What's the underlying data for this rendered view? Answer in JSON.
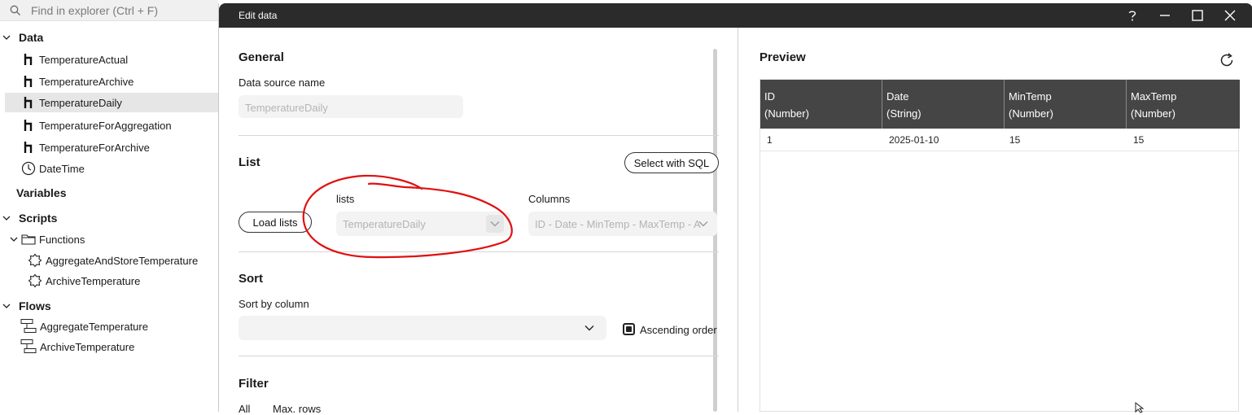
{
  "explorer": {
    "search_placeholder": "Find in explorer (Ctrl + F)",
    "sections": {
      "data": "Data",
      "variables": "Variables",
      "scripts": "Scripts",
      "flows": "Flows"
    },
    "data_items": [
      "TemperatureActual",
      "TemperatureArchive",
      "TemperatureDaily",
      "TemperatureForAggregation",
      "TemperatureForArchive",
      "DateTime"
    ],
    "functions_folder": "Functions",
    "script_items": [
      "AggregateAndStoreTemperature",
      "ArchiveTemperature"
    ],
    "flow_items": [
      "AggregateTemperature",
      "ArchiveTemperature"
    ]
  },
  "dialog": {
    "title": "Edit data",
    "general": {
      "heading": "General",
      "name_label": "Data source name",
      "name_value": "TemperatureDaily"
    },
    "list": {
      "heading": "List",
      "select_sql_label": "Select with SQL",
      "load_lists_label": "Load lists",
      "lists_label": "lists",
      "lists_value": "TemperatureDaily",
      "columns_label": "Columns",
      "columns_value": "ID - Date - MinTemp - MaxTemp - A"
    },
    "sort": {
      "heading": "Sort",
      "sort_by_label": "Sort by column",
      "sort_by_value": "",
      "ascending_label": "Ascending order",
      "ascending_checked": true
    },
    "filter": {
      "heading": "Filter",
      "all_label": "All",
      "max_rows_label": "Max. rows"
    },
    "preview": {
      "heading": "Preview",
      "columns": [
        {
          "name": "ID",
          "type": "(Number)"
        },
        {
          "name": "Date",
          "type": "(String)"
        },
        {
          "name": "MinTemp",
          "type": "(Number)"
        },
        {
          "name": "MaxTemp",
          "type": "(Number)"
        }
      ],
      "rows": [
        [
          "1",
          "2025-01-10",
          "15",
          "15"
        ]
      ]
    }
  },
  "colors": {
    "titlebar": "#2b2b2b",
    "table_header": "#454545",
    "annotation": "#e01010",
    "selected_row": "#e6e6e6"
  }
}
